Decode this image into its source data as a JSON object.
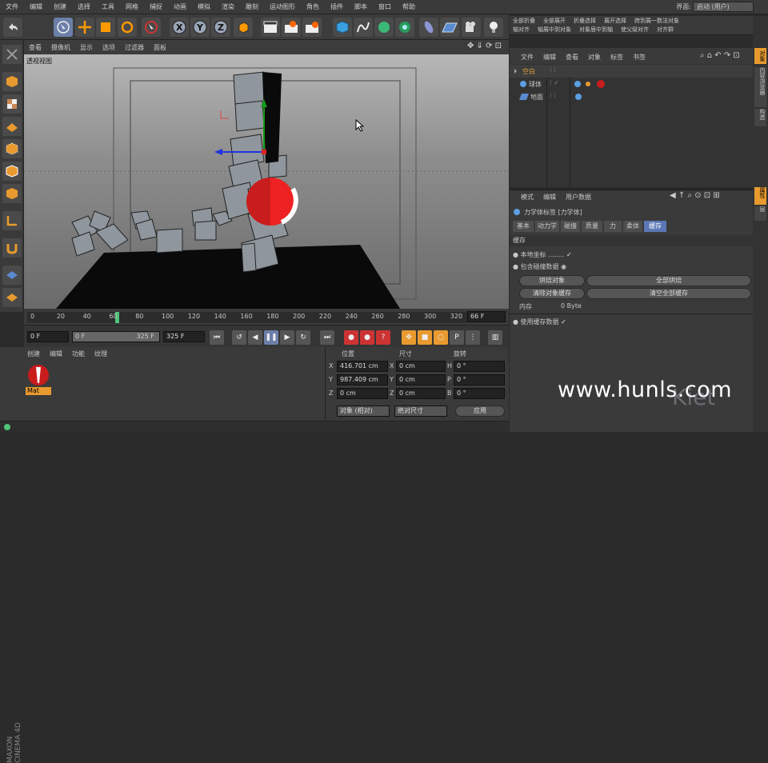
{
  "menu": [
    "文件",
    "编辑",
    "创建",
    "选择",
    "工具",
    "网格",
    "捕捉",
    "动画",
    "模拟",
    "渲染",
    "雕刻",
    "运动图形",
    "角色",
    "插件",
    "脚本",
    "窗口",
    "帮助"
  ],
  "interface": {
    "label": "界面:",
    "value": "启动 (用户)"
  },
  "right_toolbar_row1": [
    "全部折叠",
    "全部展开",
    "折叠选择",
    "展开选择",
    "跨到展一数法对象"
  ],
  "right_toolbar_row2": [
    "轴对齐",
    "轴展中到对象",
    "对象居中到轴",
    "使父级对齐",
    "对齐群"
  ],
  "viewport": {
    "menu": [
      "查看",
      "摄像机",
      "显示",
      "选项",
      "过滤器",
      "面板"
    ],
    "label": "透视视图"
  },
  "timeline": {
    "ticks": [
      "0",
      "20",
      "40",
      "60",
      "80",
      "100",
      "120",
      "140",
      "160",
      "180",
      "200",
      "220",
      "240",
      "260",
      "280",
      "300",
      "320"
    ],
    "current_frame": "66 F"
  },
  "transport": {
    "start": "0 F",
    "range_start": "0 F",
    "range_end": "325 F",
    "end": "325 F"
  },
  "material_panel": {
    "menu": [
      "创建",
      "编辑",
      "功能",
      "纹理"
    ],
    "material_name": "Mat"
  },
  "coordinates": {
    "headers": [
      "位置",
      "尺寸",
      "旋转"
    ],
    "rows": [
      {
        "axis": "X",
        "pos": "416.701 cm",
        "size_axis": "X",
        "size": "0 cm",
        "rot_axis": "H",
        "rot": "0 °"
      },
      {
        "axis": "Y",
        "pos": "987.409 cm",
        "size_axis": "Y",
        "size": "0 cm",
        "rot_axis": "P",
        "rot": "0 °"
      },
      {
        "axis": "Z",
        "pos": "0 cm",
        "size_axis": "Z",
        "size": "0 cm",
        "rot_axis": "B",
        "rot": "0 °"
      }
    ],
    "mode_select": "对象 (相对)",
    "size_select": "绝对尺寸",
    "apply_label": "应用"
  },
  "object_manager": {
    "menu": [
      "文件",
      "编辑",
      "查看",
      "对象",
      "标签",
      "书签"
    ],
    "objects": [
      {
        "name": "空白"
      },
      {
        "name": "球体"
      },
      {
        "name": "地面"
      }
    ]
  },
  "attributes": {
    "menu": [
      "模式",
      "编辑",
      "用户数据"
    ],
    "title": "力学体标签 [力学体]",
    "tabs": [
      "基本",
      "动力学",
      "碰撞",
      "质量",
      "力",
      "柔体",
      "缓存"
    ],
    "section": "缓存",
    "local_coords": "本地坐标",
    "include_collision": "包含碰撞数据",
    "buttons": [
      "烘焙对象",
      "全部烘焙",
      "清除对象缓存",
      "清空全部缓存"
    ],
    "memory_label": "内存",
    "memory_value": "0 Byte",
    "use_cache": "使用缓存数据"
  },
  "side_tabs": [
    "对象",
    "内容浏览器",
    "构造",
    "属性",
    "层"
  ],
  "brand": "MAXON CINEMA 4D",
  "watermark": "www.hunls.com",
  "watermark2": "Kiet"
}
